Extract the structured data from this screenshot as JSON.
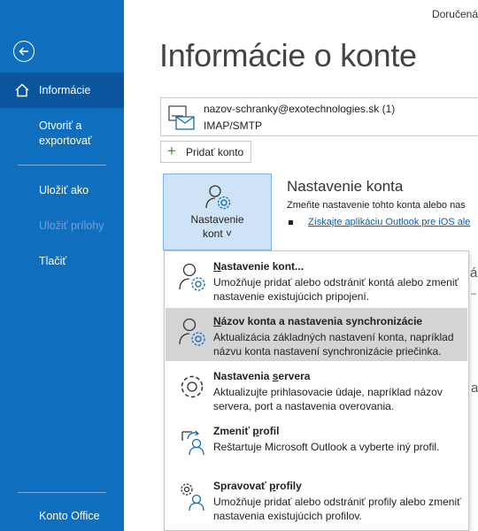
{
  "window": {
    "top_right_text": "Doručená"
  },
  "sidebar": {
    "items": [
      {
        "label": "Informácie"
      },
      {
        "label": "Otvoriť a exportovať"
      },
      {
        "label": "Uložiť ako"
      },
      {
        "label": "Uložiť prílohy"
      },
      {
        "label": "Tlačiť"
      },
      {
        "label": "Konto Office"
      }
    ]
  },
  "main": {
    "title": "Informácie o konte",
    "account": {
      "email": "nazov-schranky@exotechnologies.sk (1)",
      "type": "IMAP/SMTP"
    },
    "add_account_label": "Pridať konto",
    "settings_button": {
      "line1": "Nastavenie",
      "line2": "kont ˅"
    },
    "section": {
      "title": "Nastavenie konta",
      "description": "Zmeňte nastavenie tohto konta alebo nas",
      "link": "Získajte aplikáciu Outlook pre iOS ale"
    }
  },
  "menu": {
    "items": [
      {
        "title_pre": "",
        "title_u": "N",
        "title_post": "astavenie kont...",
        "description": "Umožňuje pridať alebo odstrániť kontá alebo zmeniť nastavenie existujúcich pripojení."
      },
      {
        "title_pre": "",
        "title_u": "N",
        "title_post": "ázov konta a nastavenia synchronizácie",
        "description": "Aktualizácia základných nastavení konta, napríklad názvu konta nastavení synchronizácie priečinka."
      },
      {
        "title_pre": "Nastavenia ",
        "title_u": "s",
        "title_post": "ervera",
        "description": "Aktualizujte prihlasovacie údaje, napríklad názov servera, port a nastavenia overovania."
      },
      {
        "title_pre": "Zmeniť ",
        "title_u": "p",
        "title_post": "rofil",
        "description": "Reštartuje Microsoft Outlook a vyberte iný profil."
      },
      {
        "title_pre": "Spravovať ",
        "title_u": "p",
        "title_post": "rofily",
        "description": "Umožňuje pridať alebo odstrániť profily alebo zmeniť nastavenia existujúcich profilov."
      }
    ]
  }
}
